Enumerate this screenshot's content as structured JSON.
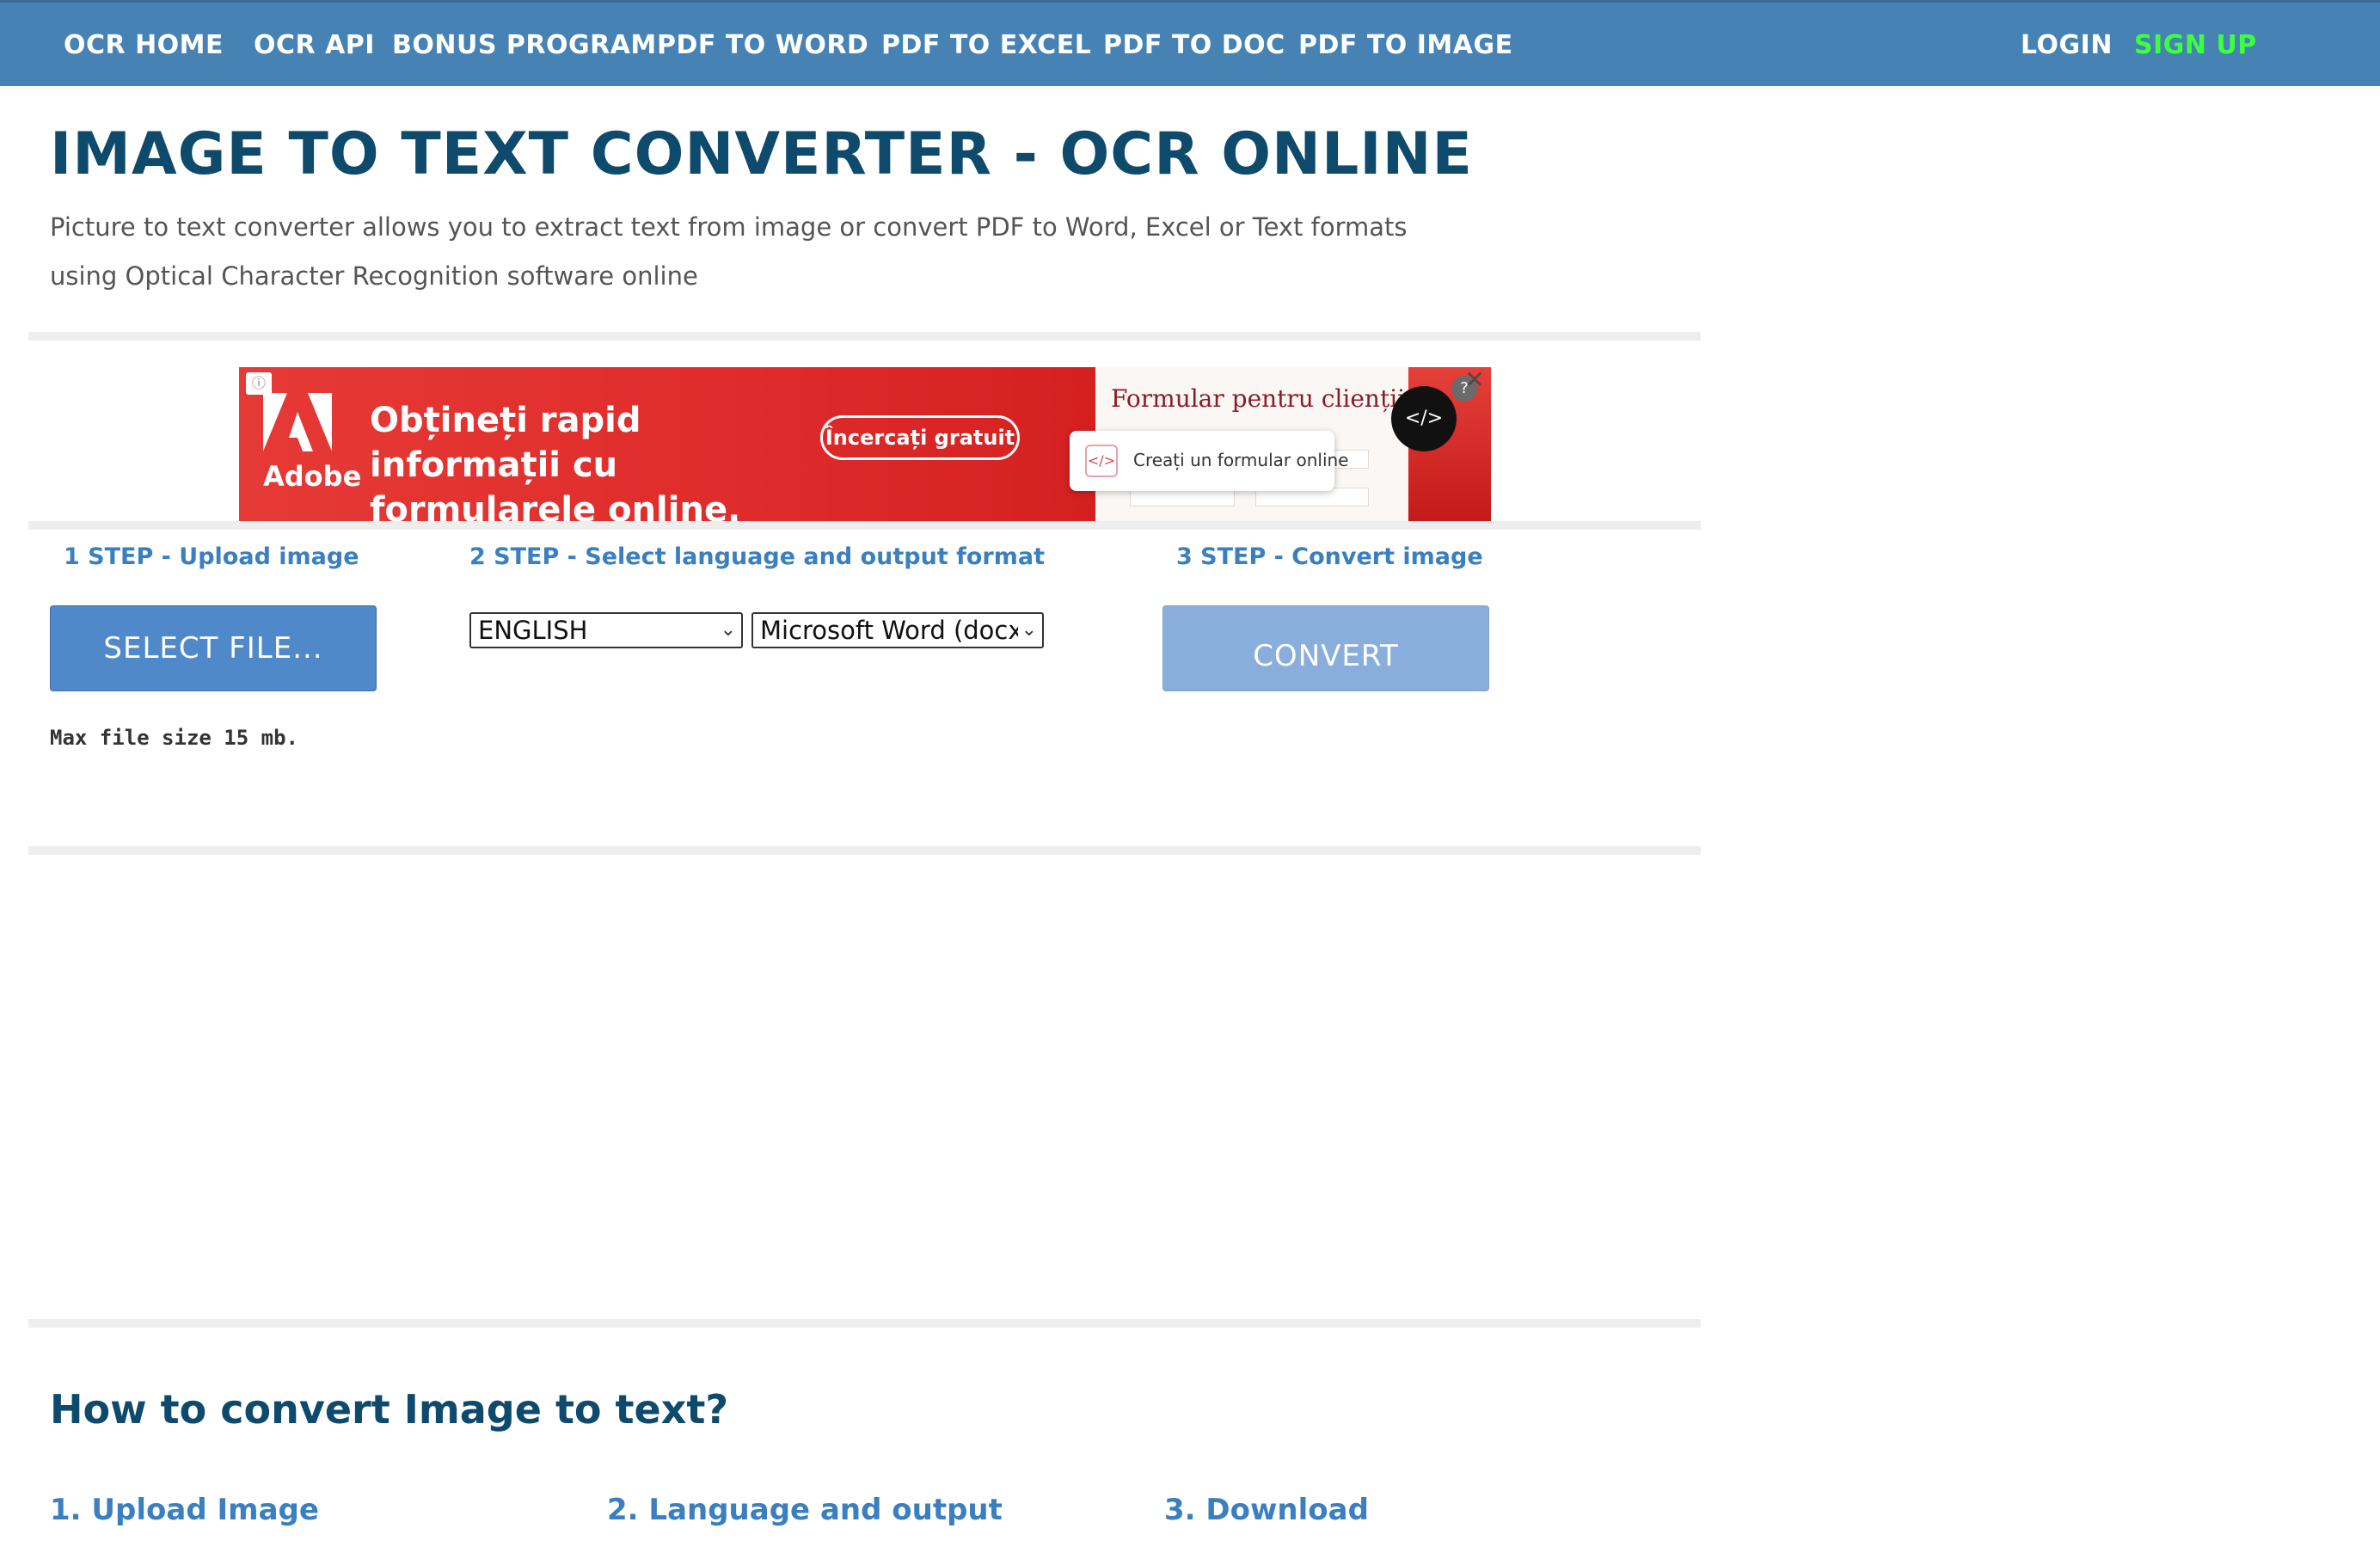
{
  "nav": {
    "items": [
      "OCR HOME",
      "OCR API",
      "BONUS PROGRAM",
      "PDF TO WORD",
      "PDF TO EXCEL",
      "PDF TO DOC",
      "PDF TO IMAGE"
    ],
    "login": "LOGIN",
    "signup": "SIGN UP"
  },
  "colors": {
    "topbar": "#4682b4",
    "title": "#0d4a6c",
    "step_label": "#3a7fbf",
    "signup": "#3dff3d",
    "select_button": "#4f89c9",
    "convert_button": "#8aaedb"
  },
  "header": {
    "title": "IMAGE TO TEXT CONVERTER - OCR ONLINE",
    "subtitle": "Picture to text converter allows you to extract text from image or convert PDF to Word, Excel or Text formats using Optical Character Recognition software online"
  },
  "ad": {
    "brand": "Adobe",
    "headline": "Obțineți rapid informații cu formularele online.",
    "cta": "Încercați gratuit",
    "right_title": "Formular pentru clienții noi",
    "popup_text": "Creați un formular online",
    "icons": [
      "ad-choices-icon",
      "adobe-logo-icon",
      "code-icon",
      "help-icon",
      "close-icon"
    ]
  },
  "steps": {
    "step1_label": "1 STEP - Upload image",
    "step2_label": "2 STEP - Select language and output format",
    "step3_label": "3 STEP - Convert image",
    "select_file": "SELECT FILE...",
    "language": "ENGLISH",
    "format": "Microsoft Word (docx)",
    "convert": "CONVERT",
    "max_size": "Max file size 15 mb."
  },
  "how": {
    "title": "How to convert Image to text?",
    "steps": [
      "1. Upload Image",
      "2. Language and output",
      "3. Download"
    ]
  }
}
